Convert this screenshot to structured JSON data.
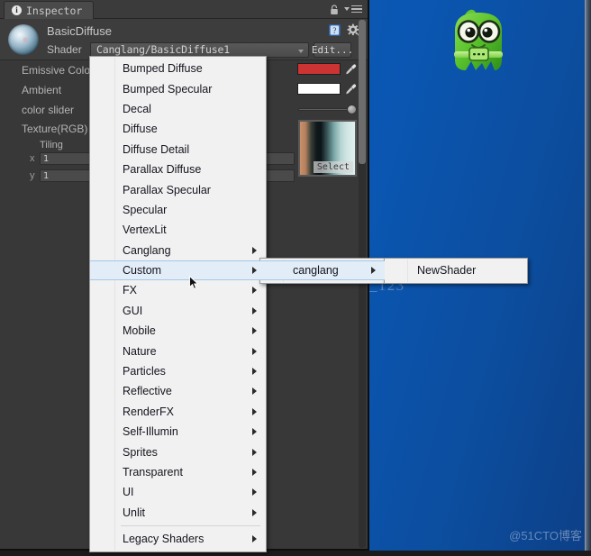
{
  "desktop": {
    "background_color": "#0c57b0",
    "watermark_url": "http://blog.csdn.net/canglang_123",
    "watermark_brand": "@51CTO博客",
    "mascot_icon": "green-monster-mascot"
  },
  "inspector": {
    "tab_label": "Inspector",
    "tab_icon": "info-icon",
    "lock_icon": "lock-icon",
    "menu_icon": "hamburger-menu-icon",
    "material_name": "BasicDiffuse",
    "help_icon": "help-book-icon",
    "gear_icon": "gear-icon",
    "preview_icon": "material-sphere-preview",
    "shader": {
      "label": "Shader",
      "value": "Canglang/BasicDiffuse1",
      "edit_label": "Edit...",
      "caret_icon": "chevron-down-icon"
    },
    "properties": [
      {
        "label": "Emissive Colo",
        "type": "color",
        "color": "#cc3333",
        "eyedropper_icon": "eyedropper-icon"
      },
      {
        "label": "Ambient",
        "type": "color",
        "color": "#ffffff",
        "eyedropper_icon": "eyedropper-icon"
      },
      {
        "label": "color slider",
        "type": "slider",
        "value": "1"
      },
      {
        "label": "Texture(RGB)",
        "type": "texture",
        "select_label": "Select"
      }
    ],
    "tiling": {
      "label": "Tiling",
      "x_label": "x",
      "x_value": "1",
      "y_label": "y",
      "y_value": "1"
    }
  },
  "menu": {
    "items": [
      {
        "label": "Bumped Diffuse",
        "submenu": false,
        "selected": false
      },
      {
        "label": "Bumped Specular",
        "submenu": false,
        "selected": false
      },
      {
        "label": "Decal",
        "submenu": false,
        "selected": false
      },
      {
        "label": "Diffuse",
        "submenu": false,
        "selected": false
      },
      {
        "label": "Diffuse Detail",
        "submenu": false,
        "selected": false
      },
      {
        "label": "Parallax Diffuse",
        "submenu": false,
        "selected": false
      },
      {
        "label": "Parallax Specular",
        "submenu": false,
        "selected": false
      },
      {
        "label": "Specular",
        "submenu": false,
        "selected": false
      },
      {
        "label": "VertexLit",
        "submenu": false,
        "selected": false
      },
      {
        "label": "Canglang",
        "submenu": true,
        "selected": false
      },
      {
        "label": "Custom",
        "submenu": true,
        "selected": true
      },
      {
        "label": "FX",
        "submenu": true,
        "selected": false
      },
      {
        "label": "GUI",
        "submenu": true,
        "selected": false
      },
      {
        "label": "Mobile",
        "submenu": true,
        "selected": false
      },
      {
        "label": "Nature",
        "submenu": true,
        "selected": false
      },
      {
        "label": "Particles",
        "submenu": true,
        "selected": false
      },
      {
        "label": "Reflective",
        "submenu": true,
        "selected": false
      },
      {
        "label": "RenderFX",
        "submenu": true,
        "selected": false
      },
      {
        "label": "Self-Illumin",
        "submenu": true,
        "selected": false
      },
      {
        "label": "Sprites",
        "submenu": true,
        "selected": false
      },
      {
        "label": "Transparent",
        "submenu": true,
        "selected": false
      },
      {
        "label": "UI",
        "submenu": true,
        "selected": false
      },
      {
        "label": "Unlit",
        "submenu": true,
        "selected": false
      }
    ],
    "separator_after_index": 22,
    "footer_items": [
      {
        "label": "Legacy Shaders",
        "submenu": true,
        "selected": false
      }
    ]
  },
  "submenu2": {
    "items": [
      {
        "label": "canglang",
        "submenu": true,
        "selected": true
      }
    ]
  },
  "submenu3": {
    "items": [
      {
        "label": "NewShader",
        "submenu": false,
        "selected": false
      }
    ]
  },
  "colors": {
    "menu_highlight": "#e3edf8",
    "menu_highlight_border": "#a4c8e8",
    "inspector_bg": "#383838",
    "emissive": "#cc3333",
    "ambient": "#ffffff"
  }
}
